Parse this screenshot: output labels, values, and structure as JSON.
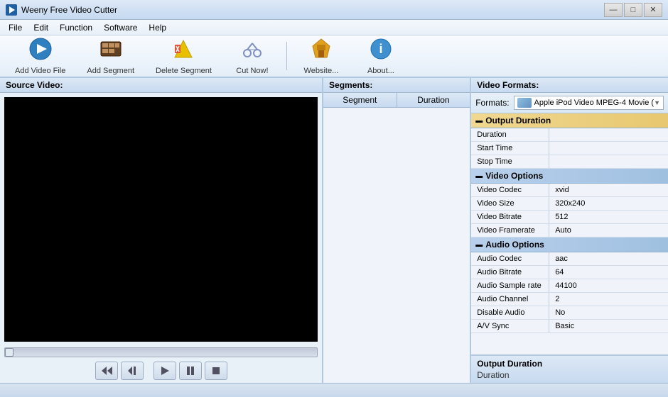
{
  "titleBar": {
    "icon": "🎬",
    "title": "Weeny Free Video Cutter",
    "minimize": "—",
    "maximize": "□",
    "close": "✕"
  },
  "menuBar": {
    "items": [
      "File",
      "Edit",
      "Function",
      "Software",
      "Help"
    ]
  },
  "toolbar": {
    "buttons": [
      {
        "id": "add-video-file",
        "icon": "🎥",
        "label": "Add Video File"
      },
      {
        "id": "add-segment",
        "icon": "🎞",
        "label": "Add Segment"
      },
      {
        "id": "delete-segment",
        "icon": "❌",
        "label": "Delete Segment"
      },
      {
        "id": "cut-now",
        "icon": "✂",
        "label": "Cut Now!"
      },
      {
        "id": "website",
        "icon": "🏠",
        "label": "Website..."
      },
      {
        "id": "about",
        "icon": "ℹ",
        "label": "About..."
      }
    ]
  },
  "sourcePanel": {
    "header": "Source Video:",
    "controls": {
      "rewind": "◄◄",
      "prev": "◄",
      "play": "►",
      "pause": "⏸",
      "stop": "■"
    }
  },
  "segmentsPanel": {
    "header": "Segments:",
    "columns": [
      "Segment",
      "Duration"
    ]
  },
  "formatsPanel": {
    "header": "Video Formats:",
    "formatLabel": "Formats:",
    "selectedFormat": "Apple iPod Video MPEG-4 Movie (",
    "sections": [
      {
        "id": "output-duration",
        "title": "Output Duration",
        "highlighted": true,
        "collapsed": false,
        "properties": [
          {
            "name": "Duration",
            "value": ""
          },
          {
            "name": "Start Time",
            "value": ""
          },
          {
            "name": "Stop Time",
            "value": ""
          }
        ]
      },
      {
        "id": "video-options",
        "title": "Video Options",
        "highlighted": false,
        "collapsed": false,
        "properties": [
          {
            "name": "Video Codec",
            "value": "xvid"
          },
          {
            "name": "Video Size",
            "value": "320x240"
          },
          {
            "name": "Video Bitrate",
            "value": "512"
          },
          {
            "name": "Video Framerate",
            "value": "Auto"
          }
        ]
      },
      {
        "id": "audio-options",
        "title": "Audio Options",
        "highlighted": false,
        "collapsed": false,
        "properties": [
          {
            "name": "Audio Codec",
            "value": "aac"
          },
          {
            "name": "Audio Bitrate",
            "value": "64"
          },
          {
            "name": "Audio Sample rate",
            "value": "44100"
          },
          {
            "name": "Audio Channel",
            "value": "2"
          },
          {
            "name": "Disable Audio",
            "value": "No"
          },
          {
            "name": "A/V Sync",
            "value": "Basic"
          }
        ]
      }
    ],
    "outputDuration": {
      "title": "Output Duration",
      "value": "Duration"
    }
  },
  "statusBar": {
    "text": ""
  }
}
